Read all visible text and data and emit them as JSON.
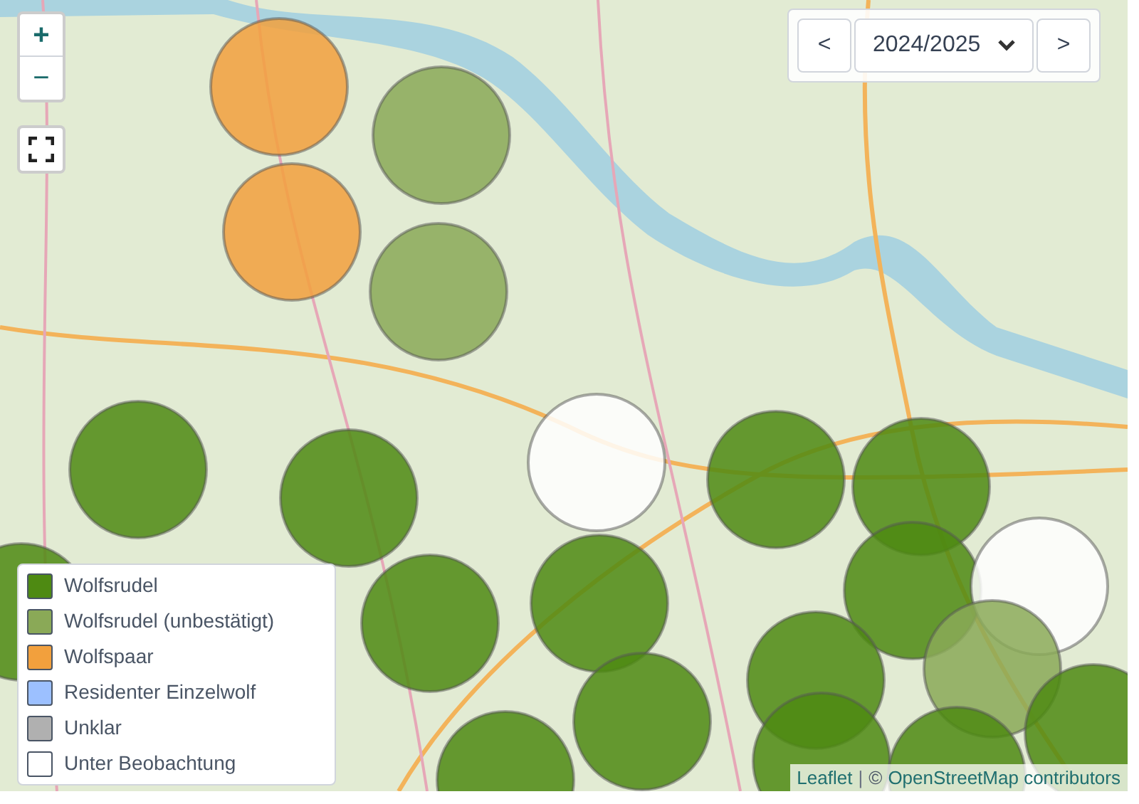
{
  "zoom_controls": {
    "zoom_in": "+",
    "zoom_out": "−"
  },
  "season_selector": {
    "prev": "<",
    "value": "2024/2025",
    "next": ">"
  },
  "legend": [
    {
      "kind": "rudel",
      "label": "Wolfsrudel",
      "color": "#4e8a12"
    },
    {
      "kind": "rudel_unconfirmed",
      "label": "Wolfsrudel (unbestätigt)",
      "color": "#8aa957"
    },
    {
      "kind": "pair",
      "label": "Wolfspaar",
      "color": "#f2a03d"
    },
    {
      "kind": "single",
      "label": "Residenter Einzelwolf",
      "color": "#9cc0ff"
    },
    {
      "kind": "unclear",
      "label": "Unklar",
      "color": "#b0b0b0"
    },
    {
      "kind": "observation",
      "label": "Unter Beobachtung",
      "color": "#ffffff"
    }
  ],
  "territories": [
    {
      "kind": "pair"
    },
    {
      "kind": "rudel_unconfirmed"
    },
    {
      "kind": "pair"
    },
    {
      "kind": "rudel_unconfirmed"
    },
    {
      "kind": "rudel"
    },
    {
      "kind": "rudel"
    },
    {
      "kind": "observation"
    },
    {
      "kind": "rudel"
    },
    {
      "kind": "rudel"
    },
    {
      "kind": "rudel"
    },
    {
      "kind": "rudel"
    },
    {
      "kind": "rudel"
    },
    {
      "kind": "rudel"
    },
    {
      "kind": "observation"
    },
    {
      "kind": "rudel_unconfirmed"
    },
    {
      "kind": "rudel"
    },
    {
      "kind": "rudel"
    },
    {
      "kind": "rudel"
    },
    {
      "kind": "rudel"
    },
    {
      "kind": "rudel"
    },
    {
      "kind": "rudel"
    }
  ],
  "attribution": {
    "leaflet": "Leaflet",
    "separator": "|",
    "copyright": "©",
    "osm": "OpenStreetMap contributors"
  }
}
